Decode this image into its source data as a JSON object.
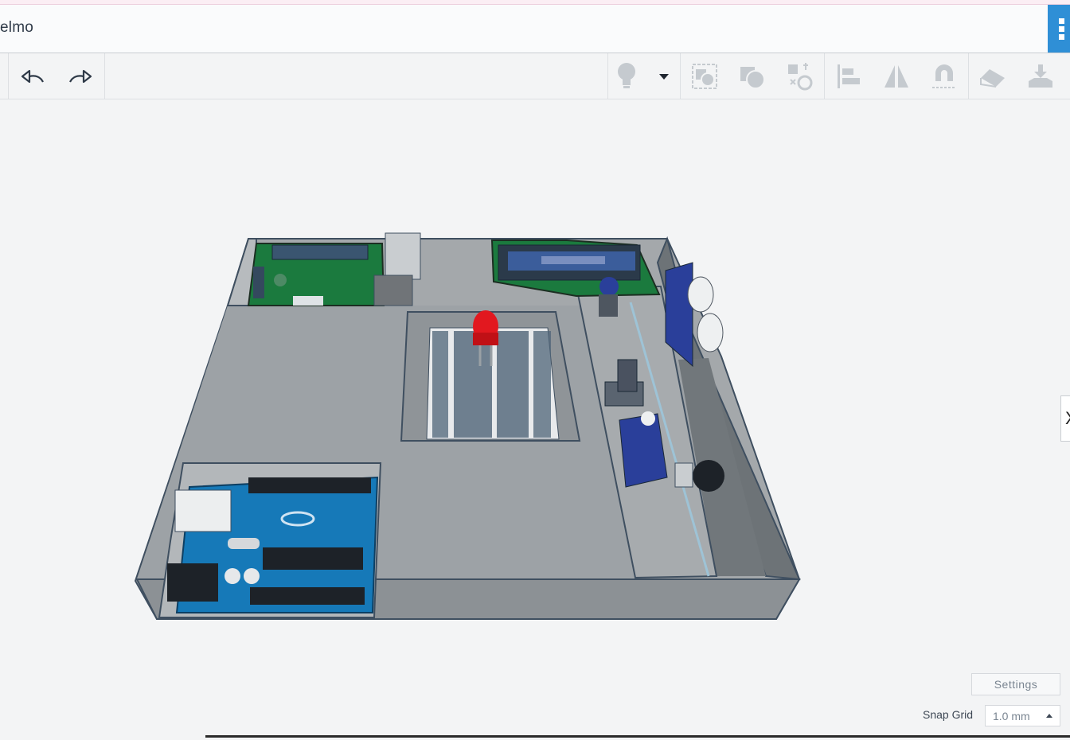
{
  "app": {
    "title": "elmo"
  },
  "toolbar": {
    "undo_icon": "undo-arrow-icon",
    "redo_icon": "redo-arrow-icon",
    "tools": [
      {
        "name": "bulb-icon"
      },
      {
        "name": "dropdown-caret-icon"
      },
      {
        "name": "group-icon"
      },
      {
        "name": "ungroup-icon"
      },
      {
        "name": "workplane-icon"
      },
      {
        "name": "align-icon"
      },
      {
        "name": "mirror-icon"
      },
      {
        "name": "cruise-icon"
      },
      {
        "name": "ruler-icon"
      },
      {
        "name": "import-icon"
      }
    ]
  },
  "canvas": {
    "settings_label": "Settings",
    "snap_grid_label": "Snap Grid",
    "snap_grid_value": "1.0 mm"
  },
  "side_panel": {
    "toggle_label": "X"
  },
  "colors": {
    "accent": "#2f8fd6",
    "model_gray": "#a4a8ab",
    "arduino_blue": "#1679b8",
    "pcb_green": "#1b7a3e",
    "led_red": "#e2181f"
  }
}
